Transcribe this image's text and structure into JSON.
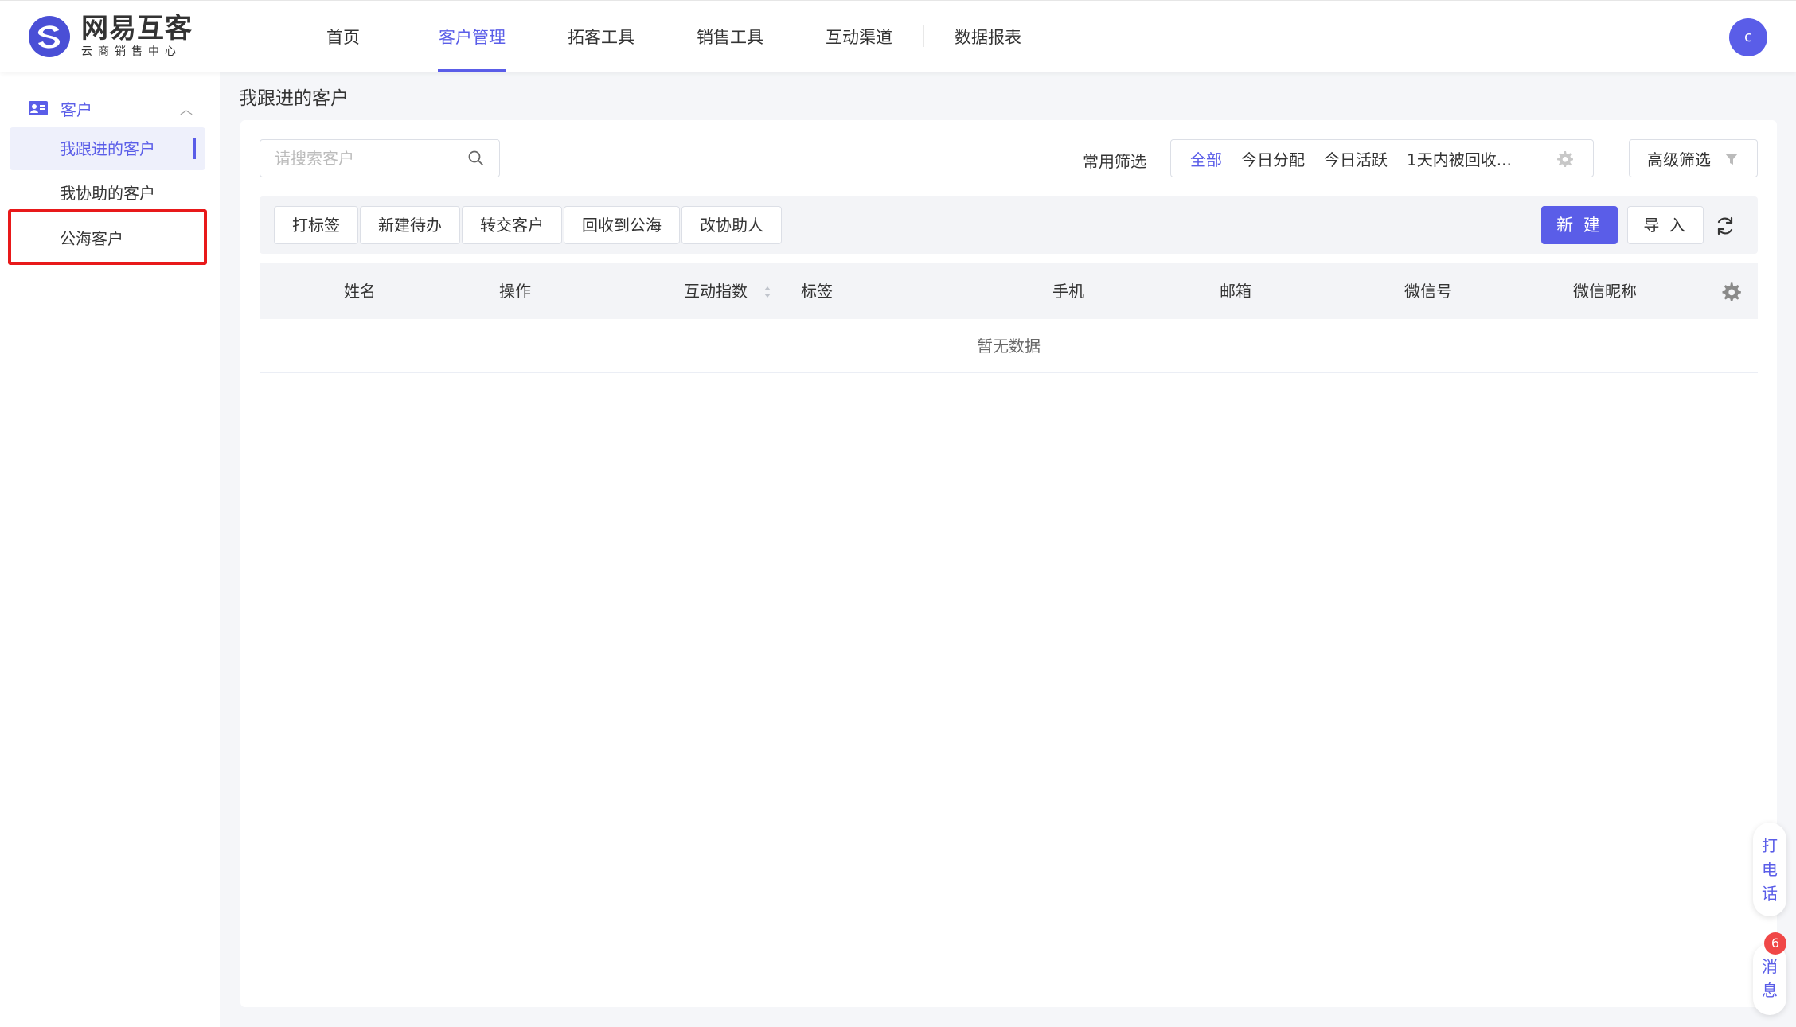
{
  "brand": {
    "title": "网易互客",
    "subtitle": "云商销售中心"
  },
  "nav": {
    "items": [
      {
        "label": "首页"
      },
      {
        "label": "客户管理"
      },
      {
        "label": "拓客工具"
      },
      {
        "label": "销售工具"
      },
      {
        "label": "互动渠道"
      },
      {
        "label": "数据报表"
      }
    ],
    "active": "客户管理"
  },
  "user": {
    "avatar_letter": "c"
  },
  "sidebar": {
    "group_label": "客户",
    "group_icon": "contact-card-icon",
    "items": [
      {
        "label": "我跟进的客户"
      },
      {
        "label": "我协助的客户"
      },
      {
        "label": "公海客户"
      }
    ],
    "active": "我跟进的客户",
    "highlighted": "公海客户"
  },
  "page": {
    "title": "我跟进的客户"
  },
  "search": {
    "placeholder": "请搜索客户",
    "value": ""
  },
  "filters": {
    "label": "常用筛选",
    "quick": [
      {
        "label": "全部"
      },
      {
        "label": "今日分配"
      },
      {
        "label": "今日活跃"
      },
      {
        "label": "1天内被回收..."
      }
    ],
    "active": "全部",
    "advanced_label": "高级筛选"
  },
  "toolbar": {
    "actions": [
      {
        "label": "打标签"
      },
      {
        "label": "新建待办"
      },
      {
        "label": "转交客户"
      },
      {
        "label": "回收到公海"
      },
      {
        "label": "改协助人"
      }
    ],
    "new_label": "新 建",
    "import_label": "导 入"
  },
  "table": {
    "columns": [
      "姓名",
      "操作",
      "互动指数",
      "标签",
      "手机",
      "邮箱",
      "微信号",
      "微信昵称"
    ],
    "sortable_column": "互动指数",
    "empty_text": "暂无数据"
  },
  "floating": {
    "call_label": [
      "打",
      "电",
      "话"
    ],
    "message_label": [
      "消",
      "息"
    ],
    "message_count": "6"
  },
  "colors": {
    "accent": "#5a5de8",
    "highlight": "#e8191a",
    "badge": "#f04747"
  }
}
